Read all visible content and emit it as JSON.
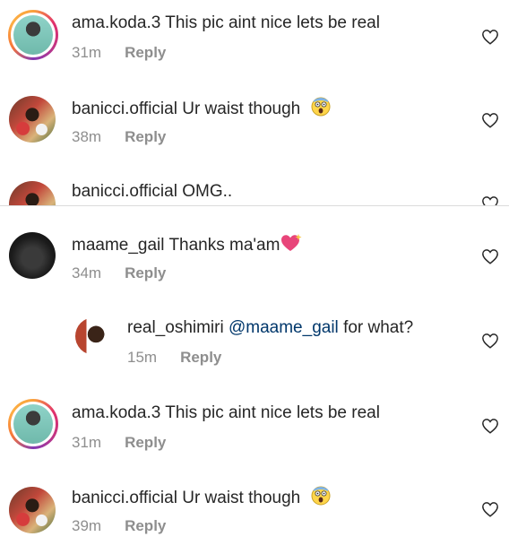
{
  "comments": [
    {
      "username": "ama.koda.3",
      "text": "This pic aint nice lets be real",
      "time": "31m",
      "reply": "Reply",
      "emoji": ""
    },
    {
      "username": "banicci.official",
      "text": "Ur waist though",
      "time": "38m",
      "reply": "Reply",
      "emoji": "face-screaming-icon"
    },
    {
      "username": "banicci.official",
      "text": "OMG..",
      "time": "",
      "reply": "",
      "emoji": ""
    },
    {
      "username": "maame_gail",
      "text": "Thanks ma'am",
      "time": "34m",
      "reply": "Reply",
      "emoji": "sparkling-heart-icon"
    },
    {
      "username": "real_oshimiri",
      "mention": "@maame_gail",
      "text": "for what?",
      "time": "15m",
      "reply": "Reply",
      "emoji": ""
    },
    {
      "username": "ama.koda.3",
      "text": "This pic aint nice lets be real",
      "time": "31m",
      "reply": "Reply",
      "emoji": ""
    },
    {
      "username": "banicci.official",
      "text": "Ur waist though",
      "time": "39m",
      "reply": "Reply",
      "emoji": "face-screaming-icon"
    }
  ],
  "icons": {
    "like": "heart-outline-icon"
  },
  "colors": {
    "text": "#262626",
    "meta": "#8e8e8e",
    "mention": "#00376b",
    "divider": "#dbdbdb"
  }
}
